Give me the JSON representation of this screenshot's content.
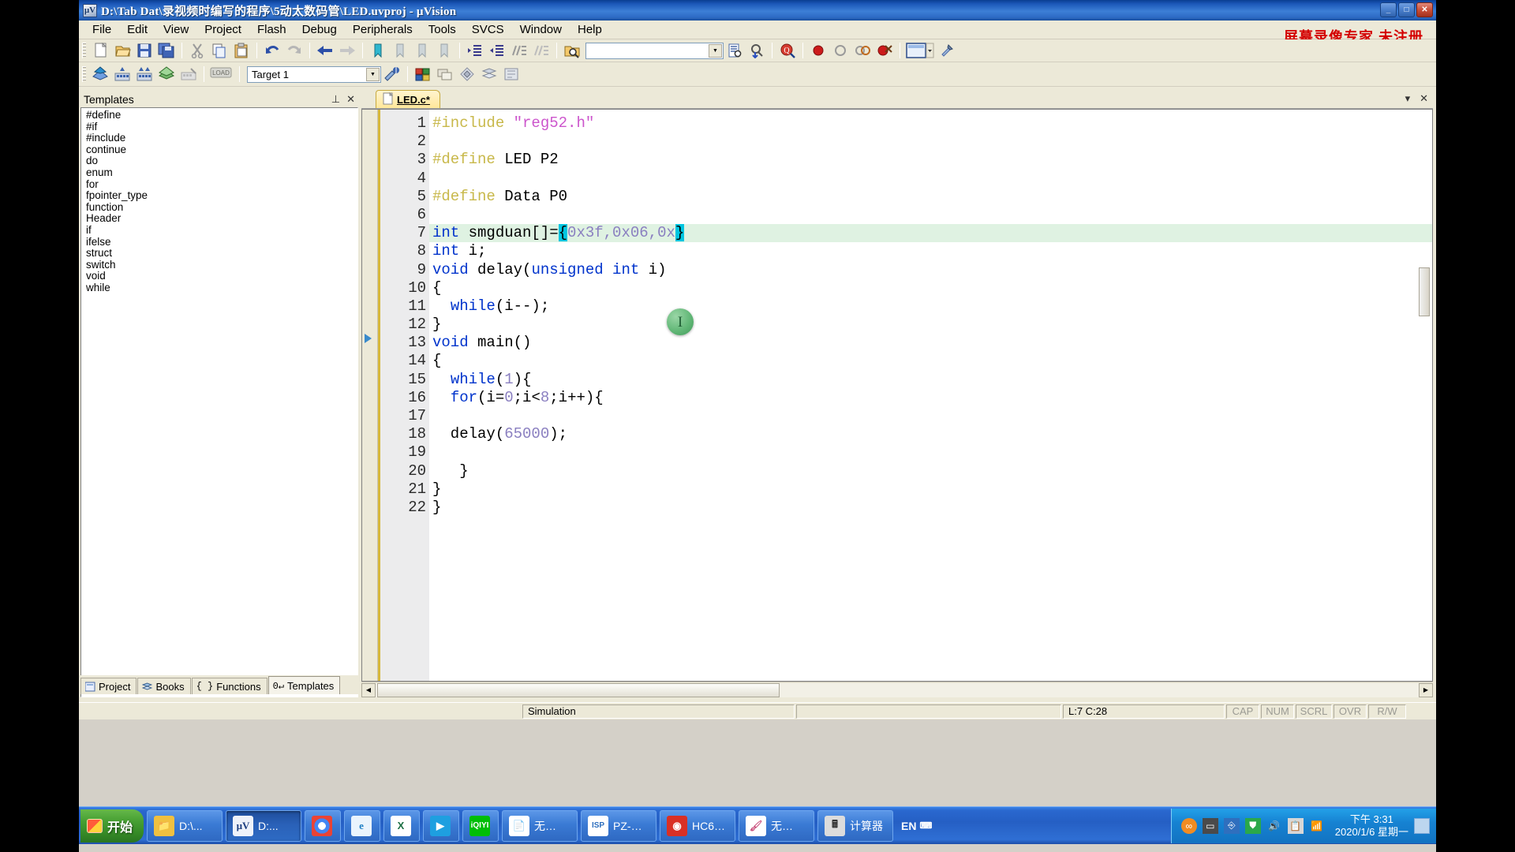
{
  "window": {
    "title": "D:\\Tab Dat\\录视频时编写的程序\\5动太数码管\\LED.uvproj - µVision",
    "app_icon_label": "µV",
    "minimize_label": "_",
    "maximize_label": "□",
    "close_label": "✕"
  },
  "watermark": "屏幕录像专家 未注册",
  "menu": {
    "items": [
      {
        "label": "File"
      },
      {
        "label": "Edit"
      },
      {
        "label": "View"
      },
      {
        "label": "Project"
      },
      {
        "label": "Flash"
      },
      {
        "label": "Debug"
      },
      {
        "label": "Peripherals"
      },
      {
        "label": "Tools"
      },
      {
        "label": "SVCS"
      },
      {
        "label": "Window"
      },
      {
        "label": "Help"
      }
    ]
  },
  "toolbar_file": {
    "buttons": [
      {
        "name": "new-file-icon",
        "tip": "New"
      },
      {
        "name": "open-file-icon",
        "tip": "Open"
      },
      {
        "name": "save-icon",
        "tip": "Save"
      },
      {
        "name": "save-all-icon",
        "tip": "Save All"
      },
      {
        "name": "cut-icon",
        "tip": "Cut"
      },
      {
        "name": "copy-icon",
        "tip": "Copy"
      },
      {
        "name": "paste-icon",
        "tip": "Paste"
      },
      {
        "name": "undo-icon",
        "tip": "Undo"
      },
      {
        "name": "redo-icon",
        "tip": "Redo"
      },
      {
        "name": "navigate-back-icon",
        "tip": "Back"
      },
      {
        "name": "navigate-forward-icon",
        "tip": "Forward"
      },
      {
        "name": "bookmark-toggle-icon",
        "tip": "Insert/Remove Bookmark"
      },
      {
        "name": "bookmark-prev-icon",
        "tip": "Previous Bookmark"
      },
      {
        "name": "bookmark-next-icon",
        "tip": "Next Bookmark"
      },
      {
        "name": "bookmark-clear-icon",
        "tip": "Clear All Bookmarks"
      },
      {
        "name": "indent-icon",
        "tip": "Indent"
      },
      {
        "name": "outdent-icon",
        "tip": "Outdent"
      },
      {
        "name": "comment-icon",
        "tip": "Comment"
      },
      {
        "name": "uncomment-icon",
        "tip": "Uncomment"
      },
      {
        "name": "find-in-files-icon",
        "tip": "Find in Files"
      }
    ],
    "find_combo_value": "",
    "find_combo_placeholder": "",
    "after_find": [
      {
        "name": "bookmark-find-icon",
        "tip": "Find"
      },
      {
        "name": "incremental-find-icon",
        "tip": "Incremental Find"
      },
      {
        "name": "browse-symbol-icon",
        "tip": "Browse Symbols"
      },
      {
        "name": "breakpoint-icon",
        "tip": "Insert/Remove Breakpoint"
      },
      {
        "name": "breakpoint-disable-icon",
        "tip": "Disable Breakpoint"
      },
      {
        "name": "breakpoint-disable-all-icon",
        "tip": "Disable All Breakpoints"
      },
      {
        "name": "breakpoint-kill-all-icon",
        "tip": "Kill All Breakpoints"
      },
      {
        "name": "window-layout-icon",
        "tip": "Manage Windows"
      },
      {
        "name": "configure-icon",
        "tip": "Configuration Wizard"
      }
    ]
  },
  "toolbar_build": {
    "buttons": [
      {
        "name": "translate-icon",
        "tip": "Translate"
      },
      {
        "name": "build-target-icon",
        "tip": "Build Target"
      },
      {
        "name": "rebuild-all-icon",
        "tip": "Rebuild All Target Files"
      },
      {
        "name": "batch-build-icon",
        "tip": "Batch Build"
      },
      {
        "name": "stop-build-icon",
        "tip": "Stop Build"
      },
      {
        "name": "download-icon",
        "tip": "Download"
      }
    ],
    "target_value": "Target 1",
    "after_target": [
      {
        "name": "target-options-icon",
        "tip": "Options for Target"
      },
      {
        "name": "manage-project-items-icon",
        "tip": "Manage Project Items"
      },
      {
        "name": "manage-multi-project-icon",
        "tip": "Manage Multi-Project"
      },
      {
        "name": "components-icon",
        "tip": "Components"
      },
      {
        "name": "books-icon",
        "tip": "Books"
      },
      {
        "name": "utilities-icon",
        "tip": "Utilities"
      }
    ]
  },
  "templates_panel": {
    "caption": "Templates",
    "pin_icon": "⊥",
    "close_icon": "✕",
    "items": [
      "#define",
      "#if",
      "#include",
      "continue",
      "do",
      "enum",
      "for",
      "fpointer_type",
      "function",
      "Header",
      "if",
      "ifelse",
      "struct",
      "switch",
      "void",
      "while"
    ],
    "tabs": [
      {
        "label": "Project",
        "icon": "project-icon",
        "active": false
      },
      {
        "label": "Books",
        "icon": "books-icon",
        "active": false
      },
      {
        "label": "Functions",
        "icon": "functions-icon",
        "active": false
      },
      {
        "label": "Templates",
        "icon": "templates-icon",
        "active": true
      }
    ]
  },
  "editor": {
    "tab_label": "LED.c*",
    "tab_icon": "c-file-icon",
    "hide_icon": "▾",
    "close_icon": "✕",
    "active_line": 7,
    "lines": [
      {
        "n": "1",
        "tokens": [
          {
            "t": "#include ",
            "c": "pp"
          },
          {
            "t": "\"reg52.h\"",
            "c": "str"
          }
        ]
      },
      {
        "n": "2",
        "tokens": []
      },
      {
        "n": "3",
        "tokens": [
          {
            "t": "#define ",
            "c": "pp"
          },
          {
            "t": "LED P2",
            "c": ""
          }
        ]
      },
      {
        "n": "4",
        "tokens": []
      },
      {
        "n": "5",
        "tokens": [
          {
            "t": "#define ",
            "c": "pp"
          },
          {
            "t": "Data P0",
            "c": ""
          }
        ]
      },
      {
        "n": "6",
        "tokens": []
      },
      {
        "n": "7",
        "tokens": [
          {
            "t": "int",
            "c": "kw"
          },
          {
            "t": " smgduan[]=",
            "c": ""
          },
          {
            "t": "{",
            "c": "sel"
          },
          {
            "t": "0x3f,0x06,0x",
            "c": "num2"
          },
          {
            "t": "}",
            "c": "sel"
          }
        ]
      },
      {
        "n": "8",
        "tokens": [
          {
            "t": "int",
            "c": "kw"
          },
          {
            "t": " i;",
            "c": ""
          }
        ]
      },
      {
        "n": "9",
        "tokens": [
          {
            "t": "void",
            "c": "kw"
          },
          {
            "t": " delay(",
            "c": ""
          },
          {
            "t": "unsigned int",
            "c": "kw"
          },
          {
            "t": " i)",
            "c": ""
          }
        ]
      },
      {
        "n": "10",
        "tokens": [
          {
            "t": "{",
            "c": ""
          }
        ]
      },
      {
        "n": "11",
        "tokens": [
          {
            "t": "  ",
            "c": ""
          },
          {
            "t": "while",
            "c": "kw"
          },
          {
            "t": "(i--);",
            "c": ""
          }
        ]
      },
      {
        "n": "12",
        "tokens": [
          {
            "t": "}",
            "c": ""
          }
        ]
      },
      {
        "n": "13",
        "tokens": [
          {
            "t": "void",
            "c": "kw"
          },
          {
            "t": " main()",
            "c": ""
          }
        ]
      },
      {
        "n": "14",
        "tokens": [
          {
            "t": "{",
            "c": ""
          }
        ]
      },
      {
        "n": "15",
        "tokens": [
          {
            "t": "  ",
            "c": ""
          },
          {
            "t": "while",
            "c": "kw"
          },
          {
            "t": "(",
            "c": ""
          },
          {
            "t": "1",
            "c": "num"
          },
          {
            "t": "){",
            "c": ""
          }
        ]
      },
      {
        "n": "16",
        "tokens": [
          {
            "t": "  ",
            "c": ""
          },
          {
            "t": "for",
            "c": "kw"
          },
          {
            "t": "(i=",
            "c": ""
          },
          {
            "t": "0",
            "c": "num"
          },
          {
            "t": ";i<",
            "c": ""
          },
          {
            "t": "8",
            "c": "num"
          },
          {
            "t": ";i++){",
            "c": ""
          }
        ]
      },
      {
        "n": "17",
        "tokens": []
      },
      {
        "n": "18",
        "tokens": [
          {
            "t": "  delay(",
            "c": ""
          },
          {
            "t": "65000",
            "c": "num"
          },
          {
            "t": ");",
            "c": ""
          }
        ]
      },
      {
        "n": "19",
        "tokens": []
      },
      {
        "n": "20",
        "tokens": [
          {
            "t": "   }",
            "c": ""
          }
        ]
      },
      {
        "n": "21",
        "tokens": [
          {
            "t": "}",
            "c": ""
          }
        ]
      },
      {
        "n": "22",
        "tokens": [
          {
            "t": "}",
            "c": ""
          }
        ]
      }
    ]
  },
  "statusbar": {
    "message": "",
    "simulation": "Simulation",
    "position": "L:7 C:28",
    "indicators": [
      "CAP",
      "NUM",
      "SCRL",
      "OVR",
      "R/W"
    ]
  },
  "taskbar": {
    "start_label": "开始",
    "quick_launch": [
      {
        "name": "explorer-qlaunch-icon",
        "label": "D:\\..."
      }
    ],
    "buttons": [
      {
        "label": "D:\\...",
        "icon": "folder-icon",
        "color": "#f0c040",
        "active": false
      },
      {
        "label": "D:...",
        "icon": "uvision-icon",
        "color": "#3b6bb5",
        "active": true
      },
      {
        "label": "",
        "icon": "chrome-icon",
        "color": "#4a90d9",
        "active": false
      },
      {
        "label": "",
        "icon": "ie-icon",
        "color": "#1e90d2",
        "active": false
      },
      {
        "label": "",
        "icon": "excel-icon",
        "color": "#1d7044",
        "active": false
      },
      {
        "label": "",
        "icon": "youku-icon",
        "color": "#1e9fe0",
        "active": false
      },
      {
        "label": "",
        "icon": "iqiyi-icon",
        "color": "#00be06",
        "active": false
      },
      {
        "label": "无…",
        "icon": "notepad-icon",
        "color": "#e6e6e6",
        "active": false
      },
      {
        "label": "PZ-…",
        "icon": "isp-icon",
        "color": "#2e6fbe",
        "active": false
      },
      {
        "label": "HC6…",
        "icon": "recorder-icon",
        "color": "#d93025",
        "active": false
      },
      {
        "label": "无…",
        "icon": "paint-icon",
        "color": "#c94f7c",
        "active": false
      },
      {
        "label": "计算器",
        "icon": "calculator-icon",
        "color": "#dcdcdc",
        "active": false
      }
    ],
    "ime": {
      "lang": "EN",
      "glyph": "⌨"
    },
    "tray_icons": [
      "link-icon",
      "monitor-icon",
      "usb-icon",
      "shield-icon",
      "volume-icon",
      "clipboard-icon",
      "network-icon"
    ],
    "clock_time": "下午 3:31",
    "clock_date": "2020/1/6 星期一",
    "show-desktop": "show-desktop-icon"
  }
}
